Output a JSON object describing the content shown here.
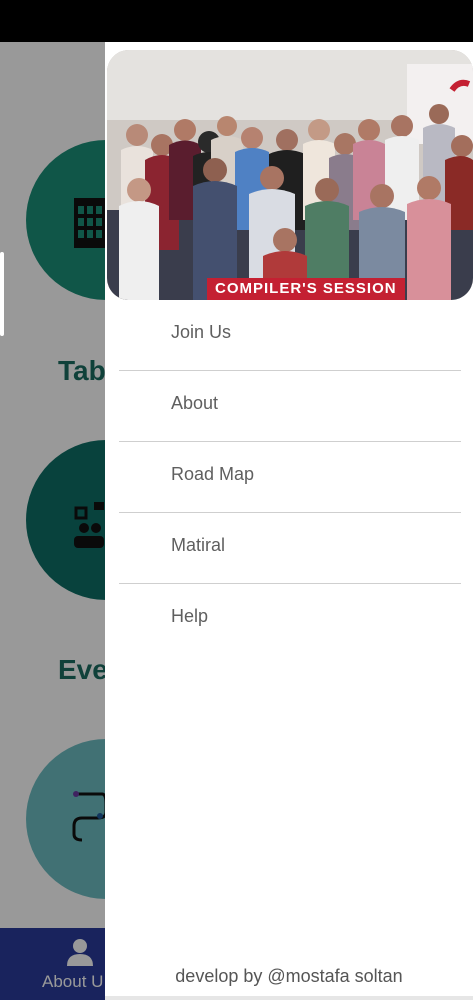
{
  "app": {
    "bg_items": [
      {
        "label": "Tab"
      },
      {
        "label": "Eve"
      }
    ],
    "bottom_nav": {
      "label": "About U"
    }
  },
  "drawer": {
    "header": {
      "banner_text": "COMPILER'S SESSION"
    },
    "menu": [
      {
        "label": "Join Us"
      },
      {
        "label": "About"
      },
      {
        "label": "Road Map"
      },
      {
        "label": "Matiral"
      },
      {
        "label": "Help"
      }
    ],
    "footer": {
      "credit": "develop by @mostafa soltan"
    }
  },
  "colors": {
    "teal": "#1c8f79",
    "dark_teal": "#0e6f66",
    "light_teal": "#6dbcc2",
    "nav_blue": "#2a3b9c",
    "banner_red": "#c42032",
    "menu_text": "#5f5f5f"
  }
}
